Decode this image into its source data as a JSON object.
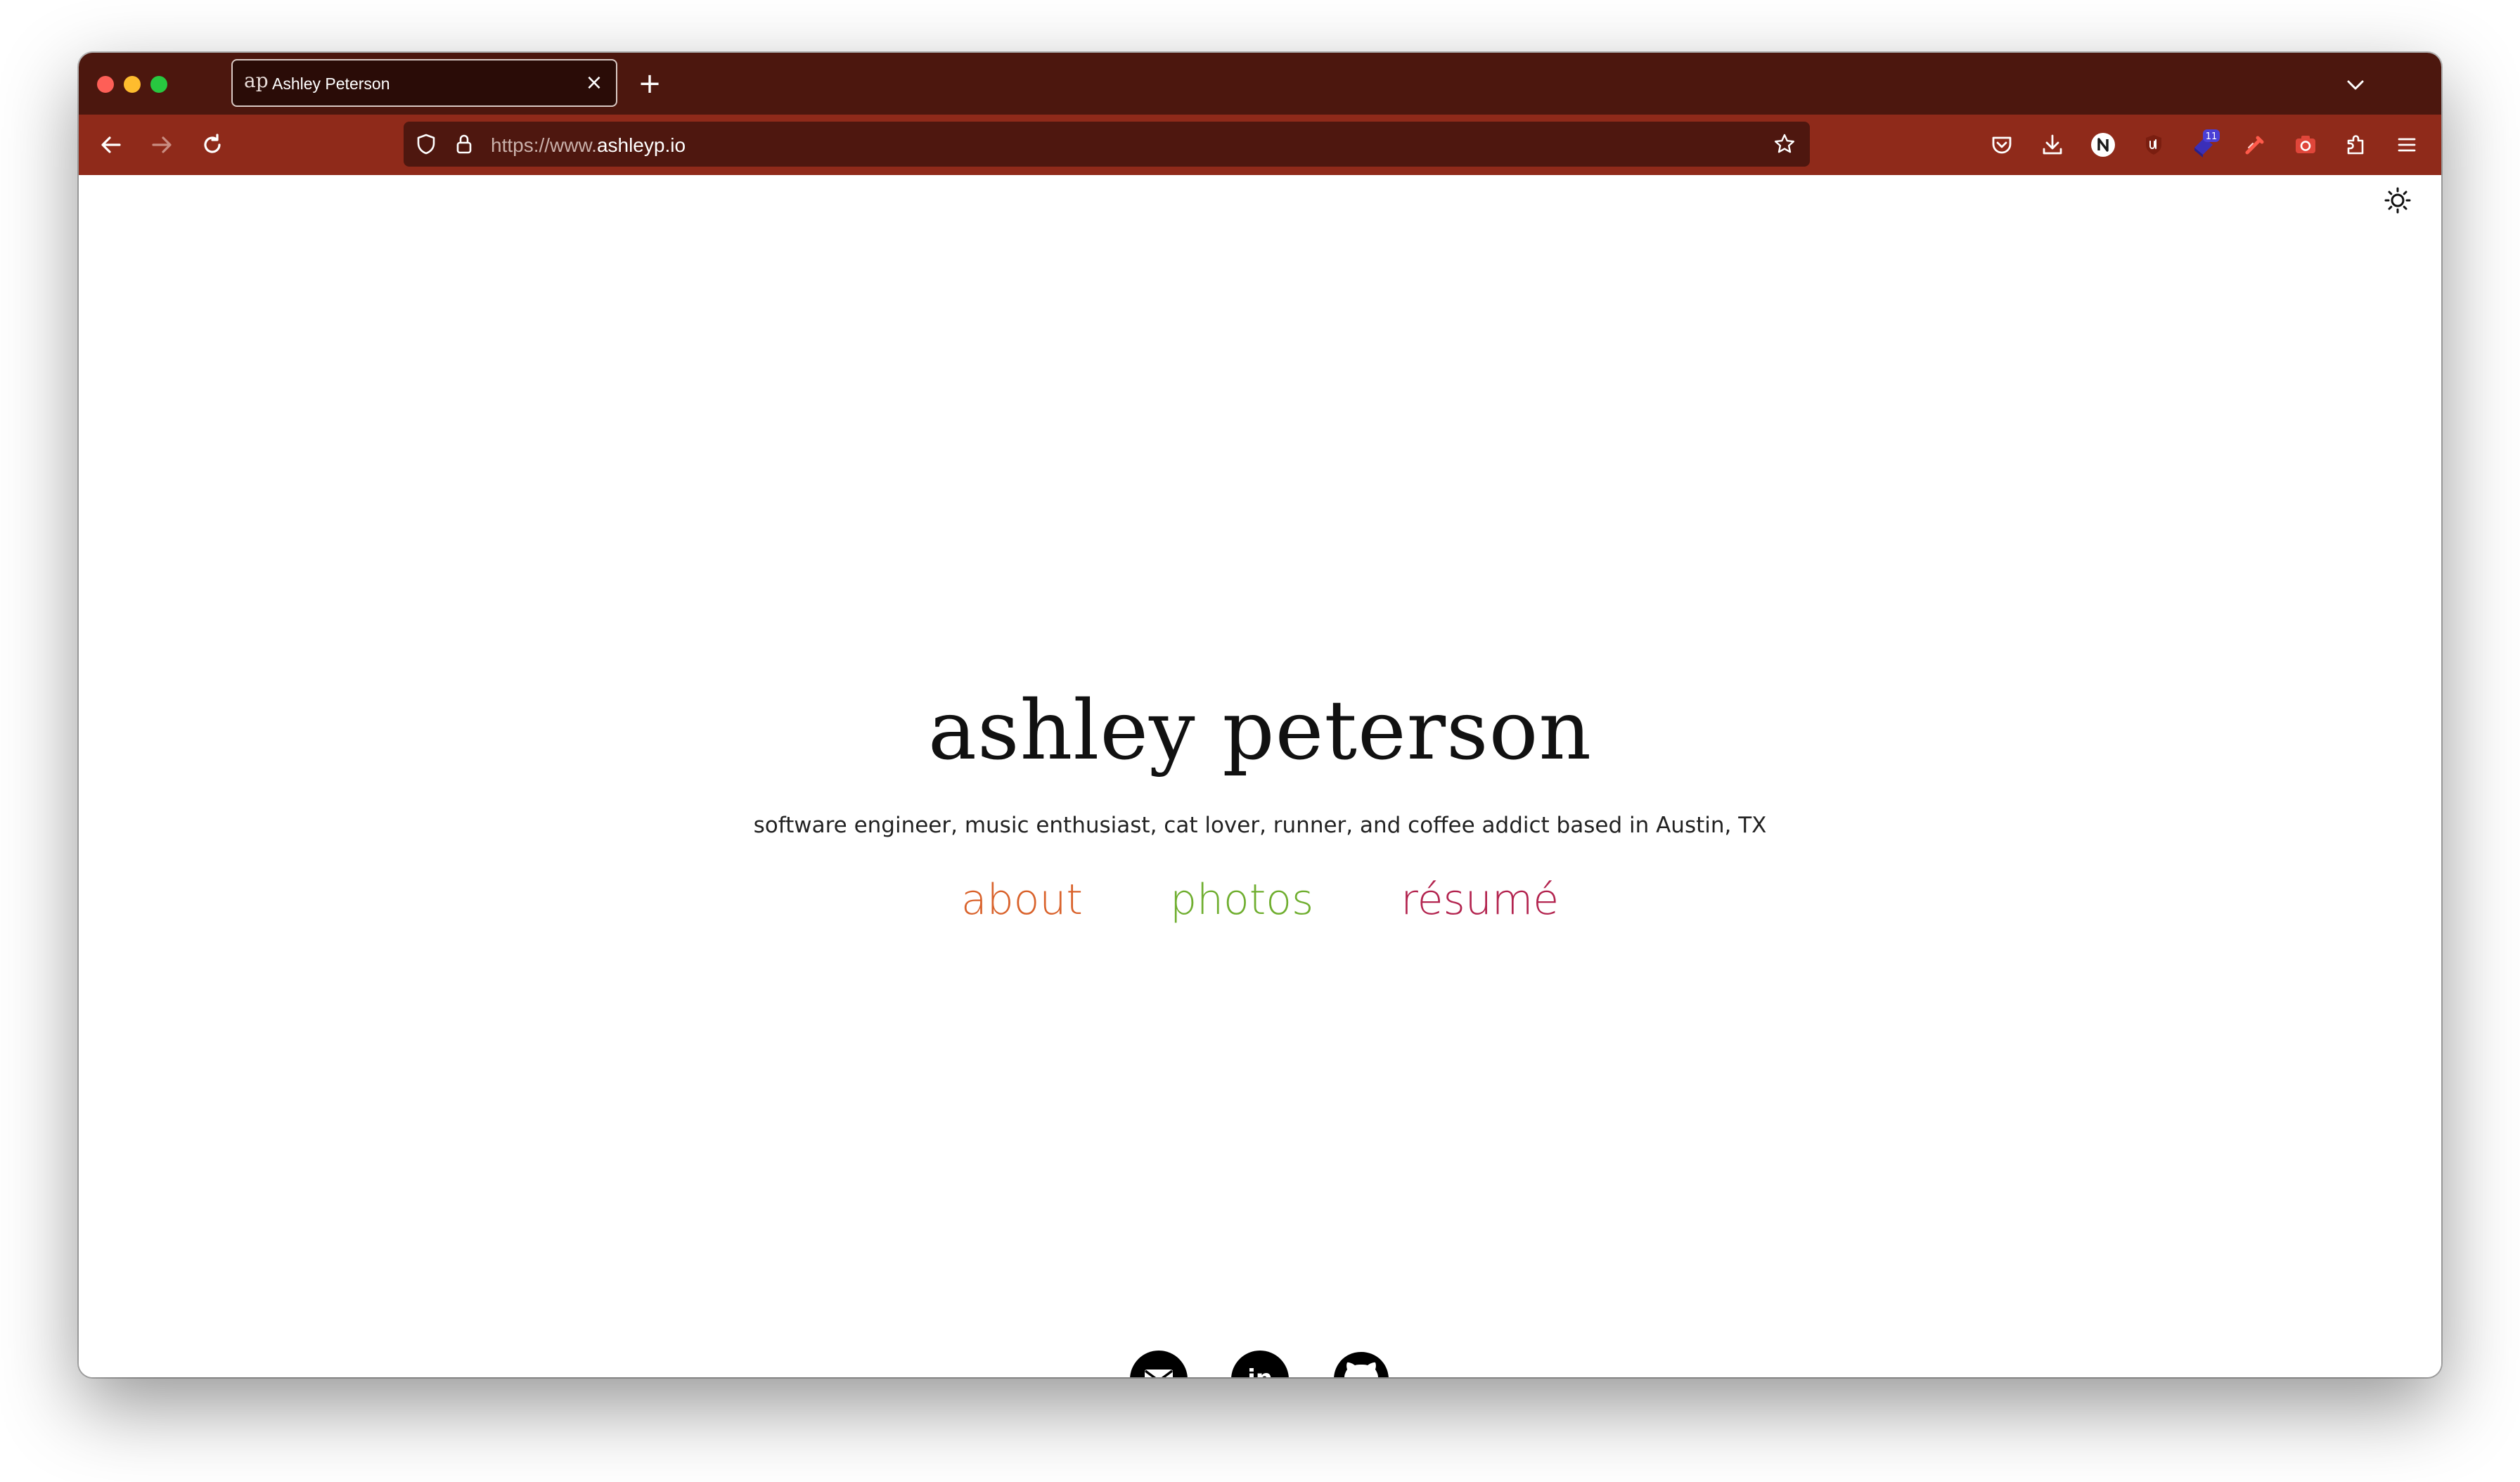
{
  "browser": {
    "tab": {
      "favicon_text": "ap",
      "title": "Ashley Peterson",
      "close_glyph": "×"
    },
    "new_tab_glyph": "+",
    "url": {
      "scheme_prefix": "https://www.",
      "domain": "ashleyp.io"
    },
    "extension_badge_count": "11",
    "toolbar_icons": [
      "pocket-icon",
      "download-icon",
      "notion-extension-icon",
      "ublock-extension-icon",
      "extension-badge-icon",
      "color-picker-extension-icon",
      "screenshot-extension-icon",
      "extensions-icon",
      "menu-icon"
    ]
  },
  "site": {
    "name": "ashley peterson",
    "tagline": "software engineer, music enthusiast, cat lover, runner, and coffee addict based in Austin, TX",
    "nav": [
      {
        "label": "about",
        "color": "#d9622b"
      },
      {
        "label": "photos",
        "color": "#6fae2f"
      },
      {
        "label": "résumé",
        "color": "#b3244f"
      }
    ],
    "social": [
      "email-icon",
      "linkedin-icon",
      "github-icon"
    ],
    "linkedin_text": "in"
  },
  "colors": {
    "tabbar": "#4c170e",
    "navbar": "#8f2a1a",
    "urlbar": "#4e170f"
  }
}
